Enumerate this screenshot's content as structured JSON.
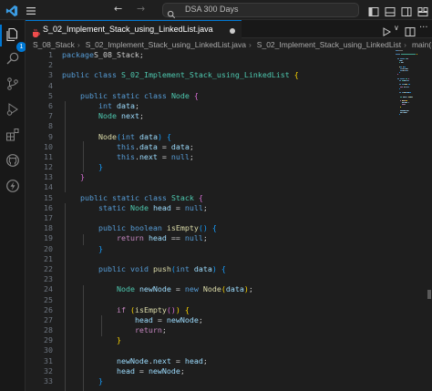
{
  "titlebar": {
    "search_text": "DSA 300 Days",
    "back_glyph": "←",
    "forward_glyph": "→"
  },
  "activitybar": {
    "explorer_badge": "1",
    "icons": [
      "explorer-icon",
      "search-icon",
      "source-control-icon",
      "run-debug-icon",
      "extensions-icon",
      "github-icon",
      "lightning-icon"
    ]
  },
  "tab": {
    "label": "S_02_Implement_Stack_using_LinkedList.java",
    "modified": true
  },
  "editor_actions": {
    "run_glyph": "▷",
    "dropdown_glyph": "∨",
    "more_glyph": "···"
  },
  "breadcrumb": {
    "folder": "S_08_Stack",
    "file": "S_02_Implement_Stack_using_LinkedList.java",
    "class": "S_02_Implement_Stack_using_LinkedList",
    "method": "main(String[])"
  },
  "code": {
    "line_numbers": [
      "1",
      "2",
      "3",
      "4",
      "5",
      "6",
      "7",
      "8",
      "9",
      "10",
      "11",
      "12",
      "13",
      "14",
      "15",
      "16",
      "17",
      "18",
      "19",
      "20",
      "21",
      "22",
      "23",
      "24",
      "25",
      "26",
      "27",
      "28",
      "29",
      "30",
      "31",
      "32",
      "33"
    ],
    "lines": [
      [
        [
          "kw",
          "package"
        ],
        [
          "",
          "S_08_Stack;"
        ]
      ],
      [],
      [
        [
          "kw",
          "public"
        ],
        [
          "",
          " "
        ],
        [
          "kw",
          "class"
        ],
        [
          "",
          " "
        ],
        [
          "ty",
          "S_02_Implement_Stack_using_LinkedList"
        ],
        [
          "",
          " "
        ],
        [
          "b1",
          "{"
        ]
      ],
      [],
      [
        [
          "",
          "    "
        ],
        [
          "kw",
          "public"
        ],
        [
          "",
          " "
        ],
        [
          "kw",
          "static"
        ],
        [
          "",
          " "
        ],
        [
          "kw",
          "class"
        ],
        [
          "",
          " "
        ],
        [
          "ty",
          "Node"
        ],
        [
          "",
          " "
        ],
        [
          "b2",
          "{"
        ]
      ],
      [
        [
          "",
          "        "
        ],
        [
          "kw",
          "int"
        ],
        [
          "",
          " "
        ],
        [
          "vr",
          "data"
        ],
        [
          "",
          ";"
        ]
      ],
      [
        [
          "",
          "        "
        ],
        [
          "ty",
          "Node"
        ],
        [
          "",
          " "
        ],
        [
          "vr",
          "next"
        ],
        [
          "",
          ";"
        ]
      ],
      [],
      [
        [
          "",
          "        "
        ],
        [
          "fn",
          "Node"
        ],
        [
          "b3",
          "("
        ],
        [
          "kw",
          "int"
        ],
        [
          "",
          " "
        ],
        [
          "vr",
          "data"
        ],
        [
          "b3",
          ")"
        ],
        [
          "",
          " "
        ],
        [
          "b3",
          "{"
        ]
      ],
      [
        [
          "",
          "            "
        ],
        [
          "kw",
          "this"
        ],
        [
          "",
          "."
        ],
        [
          "vr",
          "data"
        ],
        [
          "",
          " = "
        ],
        [
          "vr",
          "data"
        ],
        [
          "",
          ";"
        ]
      ],
      [
        [
          "",
          "            "
        ],
        [
          "kw",
          "this"
        ],
        [
          "",
          "."
        ],
        [
          "vr",
          "next"
        ],
        [
          "",
          " = "
        ],
        [
          "kw",
          "null"
        ],
        [
          "",
          ";"
        ]
      ],
      [
        [
          "",
          "        "
        ],
        [
          "b3",
          "}"
        ]
      ],
      [
        [
          "",
          "    "
        ],
        [
          "b2",
          "}"
        ]
      ],
      [],
      [
        [
          "",
          "    "
        ],
        [
          "kw",
          "public"
        ],
        [
          "",
          " "
        ],
        [
          "kw",
          "static"
        ],
        [
          "",
          " "
        ],
        [
          "kw",
          "class"
        ],
        [
          "",
          " "
        ],
        [
          "ty",
          "Stack"
        ],
        [
          "",
          " "
        ],
        [
          "b2",
          "{"
        ]
      ],
      [
        [
          "",
          "        "
        ],
        [
          "kw",
          "static"
        ],
        [
          "",
          " "
        ],
        [
          "ty",
          "Node"
        ],
        [
          "",
          " "
        ],
        [
          "vr",
          "head"
        ],
        [
          "",
          " = "
        ],
        [
          "kw",
          "null"
        ],
        [
          "",
          ";"
        ]
      ],
      [],
      [
        [
          "",
          "        "
        ],
        [
          "kw",
          "public"
        ],
        [
          "",
          " "
        ],
        [
          "kw",
          "boolean"
        ],
        [
          "",
          " "
        ],
        [
          "fn",
          "isEmpty"
        ],
        [
          "b3",
          "()"
        ],
        [
          "",
          " "
        ],
        [
          "b3",
          "{"
        ]
      ],
      [
        [
          "",
          "            "
        ],
        [
          "kw2",
          "return"
        ],
        [
          "",
          " "
        ],
        [
          "vr",
          "head"
        ],
        [
          "",
          " == "
        ],
        [
          "kw",
          "null"
        ],
        [
          "",
          ";"
        ]
      ],
      [
        [
          "",
          "        "
        ],
        [
          "b3",
          "}"
        ]
      ],
      [],
      [
        [
          "",
          "        "
        ],
        [
          "kw",
          "public"
        ],
        [
          "",
          " "
        ],
        [
          "kw",
          "void"
        ],
        [
          "",
          " "
        ],
        [
          "fn",
          "push"
        ],
        [
          "b3",
          "("
        ],
        [
          "kw",
          "int"
        ],
        [
          "",
          " "
        ],
        [
          "vr",
          "data"
        ],
        [
          "b3",
          ")"
        ],
        [
          "",
          " "
        ],
        [
          "b3",
          "{"
        ]
      ],
      [],
      [
        [
          "",
          "            "
        ],
        [
          "ty",
          "Node"
        ],
        [
          "",
          " "
        ],
        [
          "vr",
          "newNode"
        ],
        [
          "",
          " = "
        ],
        [
          "kw",
          "new"
        ],
        [
          "",
          " "
        ],
        [
          "fn",
          "Node"
        ],
        [
          "b1",
          "("
        ],
        [
          "vr",
          "data"
        ],
        [
          "b1",
          ")"
        ],
        [
          "",
          ";"
        ]
      ],
      [],
      [
        [
          "",
          "            "
        ],
        [
          "kw2",
          "if"
        ],
        [
          "",
          " "
        ],
        [
          "b1",
          "("
        ],
        [
          "fn",
          "isEmpty"
        ],
        [
          "b2",
          "()"
        ],
        [
          "b1",
          ")"
        ],
        [
          "",
          " "
        ],
        [
          "b1",
          "{"
        ]
      ],
      [
        [
          "",
          "                "
        ],
        [
          "vr",
          "head"
        ],
        [
          "",
          " = "
        ],
        [
          "vr",
          "newNode"
        ],
        [
          "",
          ";"
        ]
      ],
      [
        [
          "",
          "                "
        ],
        [
          "kw2",
          "return"
        ],
        [
          "",
          ";"
        ]
      ],
      [
        [
          "",
          "            "
        ],
        [
          "b1",
          "}"
        ]
      ],
      [],
      [
        [
          "",
          "            "
        ],
        [
          "vr",
          "newNode"
        ],
        [
          "",
          "."
        ],
        [
          "vr",
          "next"
        ],
        [
          "",
          " = "
        ],
        [
          "vr",
          "head"
        ],
        [
          "",
          ";"
        ]
      ],
      [
        [
          "",
          "            "
        ],
        [
          "vr",
          "head"
        ],
        [
          "",
          " = "
        ],
        [
          "vr",
          "newNode"
        ],
        [
          "",
          ";"
        ]
      ],
      [
        [
          "",
          "        "
        ],
        [
          "b3",
          "}"
        ]
      ]
    ]
  },
  "colors": {
    "accent": "#0078d4",
    "keyword": "#569cd6",
    "control": "#c586c0",
    "type": "#4ec9b0",
    "variable": "#9cdcfe",
    "function": "#dcdcaa",
    "java_icon": "#f14c4c"
  }
}
